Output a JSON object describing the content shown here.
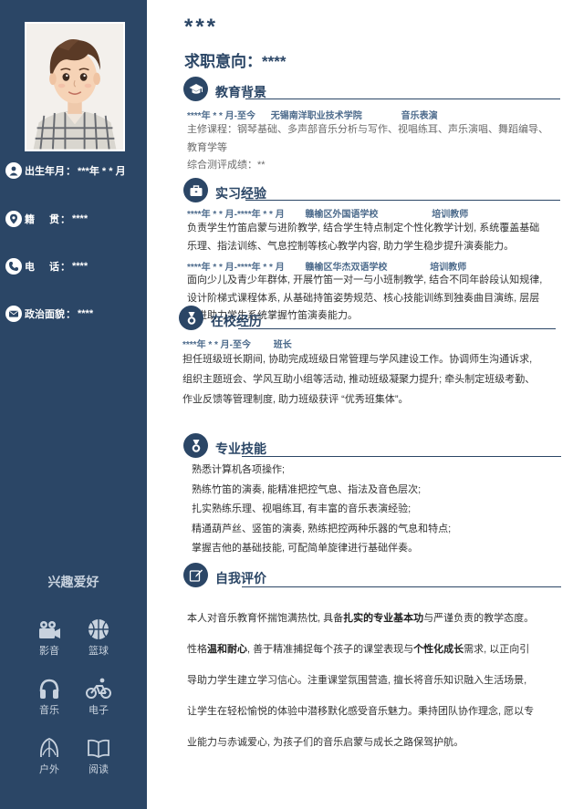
{
  "profile": {
    "name": "***",
    "intent_label": "求职意向：",
    "intent_value": "****"
  },
  "sidebar": {
    "info": [
      {
        "label": "出生年月",
        "value": "***年 * * 月",
        "icon": "person-icon"
      },
      {
        "label": "籍贯",
        "value": "****",
        "icon": "location-pin-icon"
      },
      {
        "label": "电话",
        "value": "****",
        "icon": "phone-icon"
      },
      {
        "label": "政治面貌",
        "value": "****",
        "icon": "mail-icon"
      }
    ],
    "info_sep": "：",
    "hobbies_title": "兴趣爱好",
    "hobbies": [
      {
        "label": "影音",
        "icon": "camera-icon"
      },
      {
        "label": "篮球",
        "icon": "basketball-icon"
      },
      {
        "label": "音乐",
        "icon": "headphones-icon"
      },
      {
        "label": "电子",
        "icon": "cycling-icon"
      },
      {
        "label": "户外",
        "icon": "leaf-icon"
      },
      {
        "label": "阅读",
        "icon": "book-icon"
      }
    ]
  },
  "education": {
    "title": "教育背景",
    "icon": "graduation-cap-icon",
    "period": "****年 * * 月-至今",
    "school": "无锡南洋职业技术学院",
    "major": "音乐表演",
    "courses_line1": "主修课程：钢琴基础、多声部音乐分析与写作、视唱练耳、声乐演唱、舞蹈编导、",
    "courses_line2": "教育学等",
    "gpa": "综合测评成绩：**"
  },
  "internship": {
    "title": "实习经验",
    "icon": "briefcase-icon",
    "items": [
      {
        "period": "****年 * * 月-****年 * * 月",
        "org": "赣榆区外国语学校",
        "role": "培训教师",
        "lines": [
          "负责学生竹笛启蒙与进阶教学, 结合学生特点制定个性化教学计划, 系统覆盖基础",
          "乐理、指法训练、气息控制等核心教学内容, 助力学生稳步提升演奏能力。"
        ]
      },
      {
        "period": "****年 * * 月-****年 * * 月",
        "org": "赣榆区华杰双语学校",
        "role": "培训教师",
        "lines": [
          "面向少儿及青少年群体, 开展竹笛一对一与小班制教学, 结合不同年龄段认知规律,",
          "设计阶梯式课程体系, 从基础持笛姿势规范、核心技能训练到独奏曲目演练, 层层",
          "递进助力学生系统掌握竹笛演奏能力。"
        ]
      }
    ]
  },
  "campus": {
    "title": "在校经历",
    "icon": "medal-icon",
    "period": "****年 * * 月-至今",
    "role": "班长",
    "lines": [
      "担任班级班长期间, 协助完成班级日常管理与学风建设工作。协调师生沟通诉求,",
      "组织主题班会、学风互助小组等活动, 推动班级凝聚力提升; 牵头制定班级考勤、",
      "作业反馈等管理制度, 助力班级获评 “优秀班集体”。"
    ]
  },
  "skills": {
    "title": "专业技能",
    "icon": "medal-icon",
    "lines": [
      "熟悉计算机各项操作;",
      "熟练竹笛的演奏, 能精准把控气息、指法及音色层次;",
      "扎实熟练乐理、视唱练耳, 有丰富的音乐表演经验;",
      "精通葫芦丝、竖笛的演奏, 熟练把控两种乐器的气息和特点;",
      "掌握吉他的基础技能, 可配简单旋律进行基础伴奏。"
    ]
  },
  "self_eval": {
    "title": "自我评价",
    "icon": "edit-icon",
    "line1_a": "本人对音乐教育怀揣饱满热忱, 具备",
    "line1_b": "扎实的专业基本功",
    "line1_c": "与严谨负责的教学态度。",
    "line2_a": "性格",
    "line2_b": "温和耐心",
    "line2_c": ", 善于精准捕捉每个孩子的课堂表现与",
    "line2_d": "个性化成长",
    "line2_e": "需求, 以正向引",
    "line3": "导助力学生建立学习信心。注重课堂氛围营造, 擅长将音乐知识融入生活场景,",
    "line4": "让学生在轻松愉悦的体验中潜移默化感受音乐魅力。秉持团队协作理念, 愿以专",
    "line5": "业能力与赤诚爱心, 为孩子们的音乐启蒙与成长之路保驾护航。"
  },
  "colors": {
    "sidebar": "#2b4666",
    "accent": "#2b4666",
    "meta": "#4d6b8c"
  }
}
